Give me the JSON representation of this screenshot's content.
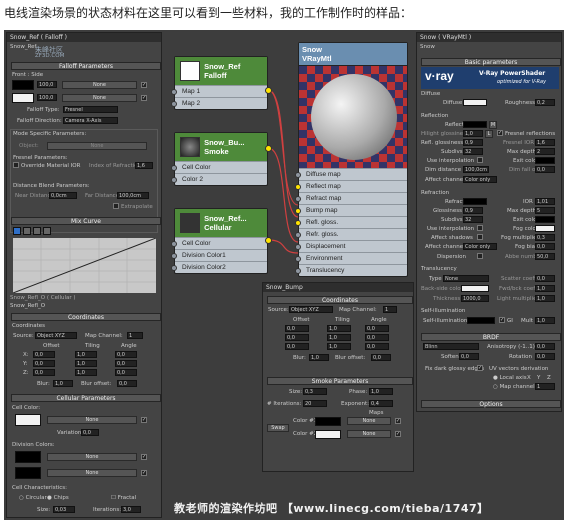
{
  "caption": "电线渲染场景的状态材料在这里可以看到一些材料，我的工作制作时的样品：",
  "left_panel": {
    "title": "Snow_Ref ( Falloff )",
    "subtitle": "Snow_Ref",
    "logo_text": "朱峰社区",
    "logo_url": "ZF3D.COM",
    "falloff_header": "Falloff Parameters",
    "front_side": "Front : Side",
    "val1": "100,0",
    "val2": "100,0",
    "none1": "None",
    "none2": "None",
    "falloff_type_label": "Falloff Type:",
    "falloff_type": "Fresnel",
    "falloff_dir_label": "Falloff Direction:",
    "falloff_dir": "Camera X-Axis",
    "mode_params": "Mode Specific Parameters:",
    "object_label": "Object:",
    "object_val": "None",
    "fresnel_params": "Fresnel Parameters:",
    "override_ior": "Override Material IOR",
    "index_refraction": "Index of Refraction",
    "ior_val": "1,6",
    "distance_blend": "Distance Blend Parameters:",
    "near_distance": "Near Distance:",
    "near_val": "0,0cm",
    "far_distance": "Far Distance:",
    "far_val": "100,0cm",
    "extrapolate": "Extrapolate",
    "mix_curve": "Mix Curve",
    "node_label": "Snow_Refl_O ( Cellular )",
    "node_sub": "Snow_Refl_O",
    "coordinates": "Coordinates",
    "coords": "Coordinates",
    "source": "Source:",
    "source_val": "Object XYZ",
    "map_channel": "Map Channel:",
    "map_channel_val": "1",
    "offset": "Offset",
    "tiling": "Tiling",
    "angle": "Angle",
    "axes": [
      "X:",
      "Y:",
      "Z:"
    ],
    "zero": "0,0",
    "one": "1,0",
    "blur": "Blur:",
    "blur_val": "1,0",
    "blur_offset": "Blur offset:",
    "blur_offset_val": "0,0",
    "cellular_header": "Cellular Parameters",
    "cell_color": "Cell Color:",
    "variation": "Variation:",
    "variation_val": "0,0",
    "division_colors": "Division Colors:",
    "none3": "None",
    "none4": "None",
    "none5": "None",
    "cell_char": "Cell Characteristics:",
    "circular": "Circular",
    "chips": "Chips",
    "fractal": "Fractal",
    "size": "Size:",
    "size_val": "0,03",
    "iterations": "Iterations:",
    "iterations_val": "3,0"
  },
  "nodes": [
    {
      "title1": "Snow_Ref",
      "title2": "Falloff",
      "rows": [
        "Map 1",
        "Map 2"
      ]
    },
    {
      "title1": "Snow_Bu...",
      "title2": "Smoke",
      "rows": [
        "Cell Color",
        "Color 2"
      ]
    },
    {
      "title1": "Snow_Ref...",
      "title2": "Cellular",
      "rows": [
        "Cell Color",
        "Division Color1",
        "Division Color2"
      ]
    }
  ],
  "vraymtl_node": {
    "title1": "Snow",
    "title2": "VRayMtl",
    "rows": [
      "Diffuse map",
      "Reflect map",
      "Refract map",
      "Bump map",
      "Refl. gloss.",
      "Refr. gloss.",
      "Displacement",
      "Environment",
      "Translucency"
    ]
  },
  "bump_panel": {
    "title": "Snow_Bump",
    "coordinates": "Coordinates",
    "source": "Source:",
    "source_val": "Object XYZ",
    "map_channel": "Map Channel:",
    "map_channel_val": "1",
    "offset": "Offset",
    "tiling": "Tiling",
    "angle": "Angle",
    "zero": "0,0",
    "one": "1,0",
    "blur": "Blur:",
    "blur_val": "1,0",
    "blur_offset": "Blur offset:",
    "blur_offset_val": "0,0",
    "smoke_header": "Smoke Parameters",
    "size": "Size:",
    "size_val": "0,3",
    "phase": "Phase:",
    "phase_val": "1,0",
    "iterations": "# Iterations:",
    "iterations_val": "20",
    "exponent": "Exponent:",
    "exponent_val": "0,4",
    "maps": "Maps",
    "swap": "Swap",
    "color1": "Color #1",
    "color2": "Color #2",
    "none1": "None",
    "none2": "None"
  },
  "right_panel": {
    "title": "Snow ( VRayMtl )",
    "subtitle": "Snow",
    "basic_params": "Basic parameters",
    "vray_brand": "V-Ray PowerShader",
    "vray_sub": "optimized for V-Ray",
    "vray_logo": "v·ray",
    "diffuse": "Diffuse",
    "diffuse_label": "Diffuse",
    "roughness": "Roughness",
    "roughness_val": "0,2",
    "reflection": "Reflection",
    "reflect": "Reflect",
    "m": "M",
    "hilight_gloss": "Hilight glossiness",
    "hilight_val": "1,0",
    "l": "L",
    "fresnel_refl": "Fresnel reflections",
    "refl_gloss": "Refl. glossiness",
    "refl_gloss_val": "0,9",
    "fresnel_ior": "Fresnel IOR",
    "fresnel_ior_val": "1,6",
    "subdivs": "Subdivs",
    "subdivs_val": "32",
    "max_depth": "Max depth",
    "max_depth_val": "2",
    "use_interp": "Use interpolation",
    "exit_color": "Exit color",
    "dim_distance": "Dim distance",
    "dim_val": "100,0cm",
    "dim_falloff": "Dim fall off",
    "dim_falloff_val": "0,0",
    "affect_channels": "Affect channels",
    "affect_val": "Color only",
    "refraction": "Refraction",
    "refract": "Refract",
    "ior": "IOR",
    "ior_val": "1,01",
    "glossiness": "Glossiness",
    "gloss_val": "0,9",
    "max_depth2_val": "5",
    "subdivs2_val": "32",
    "exit_color2": "Exit color",
    "fog_color": "Fog color",
    "fog_mult": "Fog multiplier",
    "fog_mult_val": "0,3",
    "affect_shadows": "Affect shadows",
    "fog_bias": "Fog bias",
    "fog_bias_val": "0,0",
    "affect_channels2_val": "Color only",
    "dispersion": "Dispersion",
    "abbe": "Abbe number",
    "abbe_val": "50,0",
    "translucency": "Translucency",
    "type": "Type",
    "type_val": "None",
    "scatter_coeff": "Scatter coeff",
    "scatter_val": "0,0",
    "back_side_color": "Back-side color",
    "fwd_bwd": "Fwd/bck coeff",
    "fwd_val": "1,0",
    "thickness": "Thickness",
    "thickness_val": "1000,0",
    "light_mult": "Light multiplier",
    "light_mult_val": "1,0",
    "self_illum": "Self-illumination",
    "self_illum_label": "Self-illumination",
    "gi": "GI",
    "mult": "Mult",
    "mult_val": "1,0",
    "brdf": "BRDF",
    "blinn": "Blinn",
    "anisotropy": "Anisotropy (-1..1)",
    "aniso_val": "0,0",
    "soften": "Soften",
    "soften_val": "0,0",
    "rotation": "Rotation",
    "rotation_val": "0,0",
    "fix_dark": "Fix dark glossy edges",
    "uv_vectors": "UV vectors derivation",
    "local_axis": "Local axis",
    "x": "X",
    "y": "Y",
    "z": "Z",
    "map_channel": "Map channel",
    "map_channel_val": "1",
    "options": "Options"
  },
  "watermark": "教老师的渲染作坊吧  【www.linecg.com/tieba/1747】"
}
